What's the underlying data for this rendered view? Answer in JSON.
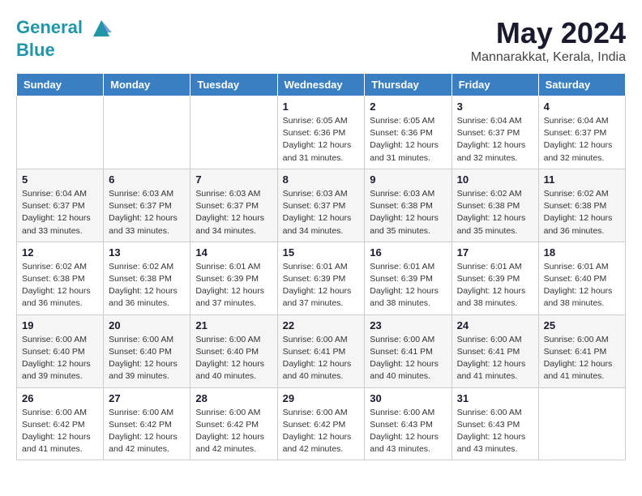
{
  "logo": {
    "line1": "General",
    "line2": "Blue"
  },
  "title": "May 2024",
  "subtitle": "Mannarakkat, Kerala, India",
  "weekdays": [
    "Sunday",
    "Monday",
    "Tuesday",
    "Wednesday",
    "Thursday",
    "Friday",
    "Saturday"
  ],
  "weeks": [
    [
      {
        "day": "",
        "info": ""
      },
      {
        "day": "",
        "info": ""
      },
      {
        "day": "",
        "info": ""
      },
      {
        "day": "1",
        "info": "Sunrise: 6:05 AM\nSunset: 6:36 PM\nDaylight: 12 hours and 31 minutes."
      },
      {
        "day": "2",
        "info": "Sunrise: 6:05 AM\nSunset: 6:36 PM\nDaylight: 12 hours and 31 minutes."
      },
      {
        "day": "3",
        "info": "Sunrise: 6:04 AM\nSunset: 6:37 PM\nDaylight: 12 hours and 32 minutes."
      },
      {
        "day": "4",
        "info": "Sunrise: 6:04 AM\nSunset: 6:37 PM\nDaylight: 12 hours and 32 minutes."
      }
    ],
    [
      {
        "day": "5",
        "info": "Sunrise: 6:04 AM\nSunset: 6:37 PM\nDaylight: 12 hours and 33 minutes."
      },
      {
        "day": "6",
        "info": "Sunrise: 6:03 AM\nSunset: 6:37 PM\nDaylight: 12 hours and 33 minutes."
      },
      {
        "day": "7",
        "info": "Sunrise: 6:03 AM\nSunset: 6:37 PM\nDaylight: 12 hours and 34 minutes."
      },
      {
        "day": "8",
        "info": "Sunrise: 6:03 AM\nSunset: 6:37 PM\nDaylight: 12 hours and 34 minutes."
      },
      {
        "day": "9",
        "info": "Sunrise: 6:03 AM\nSunset: 6:38 PM\nDaylight: 12 hours and 35 minutes."
      },
      {
        "day": "10",
        "info": "Sunrise: 6:02 AM\nSunset: 6:38 PM\nDaylight: 12 hours and 35 minutes."
      },
      {
        "day": "11",
        "info": "Sunrise: 6:02 AM\nSunset: 6:38 PM\nDaylight: 12 hours and 36 minutes."
      }
    ],
    [
      {
        "day": "12",
        "info": "Sunrise: 6:02 AM\nSunset: 6:38 PM\nDaylight: 12 hours and 36 minutes."
      },
      {
        "day": "13",
        "info": "Sunrise: 6:02 AM\nSunset: 6:38 PM\nDaylight: 12 hours and 36 minutes."
      },
      {
        "day": "14",
        "info": "Sunrise: 6:01 AM\nSunset: 6:39 PM\nDaylight: 12 hours and 37 minutes."
      },
      {
        "day": "15",
        "info": "Sunrise: 6:01 AM\nSunset: 6:39 PM\nDaylight: 12 hours and 37 minutes."
      },
      {
        "day": "16",
        "info": "Sunrise: 6:01 AM\nSunset: 6:39 PM\nDaylight: 12 hours and 38 minutes."
      },
      {
        "day": "17",
        "info": "Sunrise: 6:01 AM\nSunset: 6:39 PM\nDaylight: 12 hours and 38 minutes."
      },
      {
        "day": "18",
        "info": "Sunrise: 6:01 AM\nSunset: 6:40 PM\nDaylight: 12 hours and 38 minutes."
      }
    ],
    [
      {
        "day": "19",
        "info": "Sunrise: 6:00 AM\nSunset: 6:40 PM\nDaylight: 12 hours and 39 minutes."
      },
      {
        "day": "20",
        "info": "Sunrise: 6:00 AM\nSunset: 6:40 PM\nDaylight: 12 hours and 39 minutes."
      },
      {
        "day": "21",
        "info": "Sunrise: 6:00 AM\nSunset: 6:40 PM\nDaylight: 12 hours and 40 minutes."
      },
      {
        "day": "22",
        "info": "Sunrise: 6:00 AM\nSunset: 6:41 PM\nDaylight: 12 hours and 40 minutes."
      },
      {
        "day": "23",
        "info": "Sunrise: 6:00 AM\nSunset: 6:41 PM\nDaylight: 12 hours and 40 minutes."
      },
      {
        "day": "24",
        "info": "Sunrise: 6:00 AM\nSunset: 6:41 PM\nDaylight: 12 hours and 41 minutes."
      },
      {
        "day": "25",
        "info": "Sunrise: 6:00 AM\nSunset: 6:41 PM\nDaylight: 12 hours and 41 minutes."
      }
    ],
    [
      {
        "day": "26",
        "info": "Sunrise: 6:00 AM\nSunset: 6:42 PM\nDaylight: 12 hours and 41 minutes."
      },
      {
        "day": "27",
        "info": "Sunrise: 6:00 AM\nSunset: 6:42 PM\nDaylight: 12 hours and 42 minutes."
      },
      {
        "day": "28",
        "info": "Sunrise: 6:00 AM\nSunset: 6:42 PM\nDaylight: 12 hours and 42 minutes."
      },
      {
        "day": "29",
        "info": "Sunrise: 6:00 AM\nSunset: 6:42 PM\nDaylight: 12 hours and 42 minutes."
      },
      {
        "day": "30",
        "info": "Sunrise: 6:00 AM\nSunset: 6:43 PM\nDaylight: 12 hours and 43 minutes."
      },
      {
        "day": "31",
        "info": "Sunrise: 6:00 AM\nSunset: 6:43 PM\nDaylight: 12 hours and 43 minutes."
      },
      {
        "day": "",
        "info": ""
      }
    ]
  ]
}
